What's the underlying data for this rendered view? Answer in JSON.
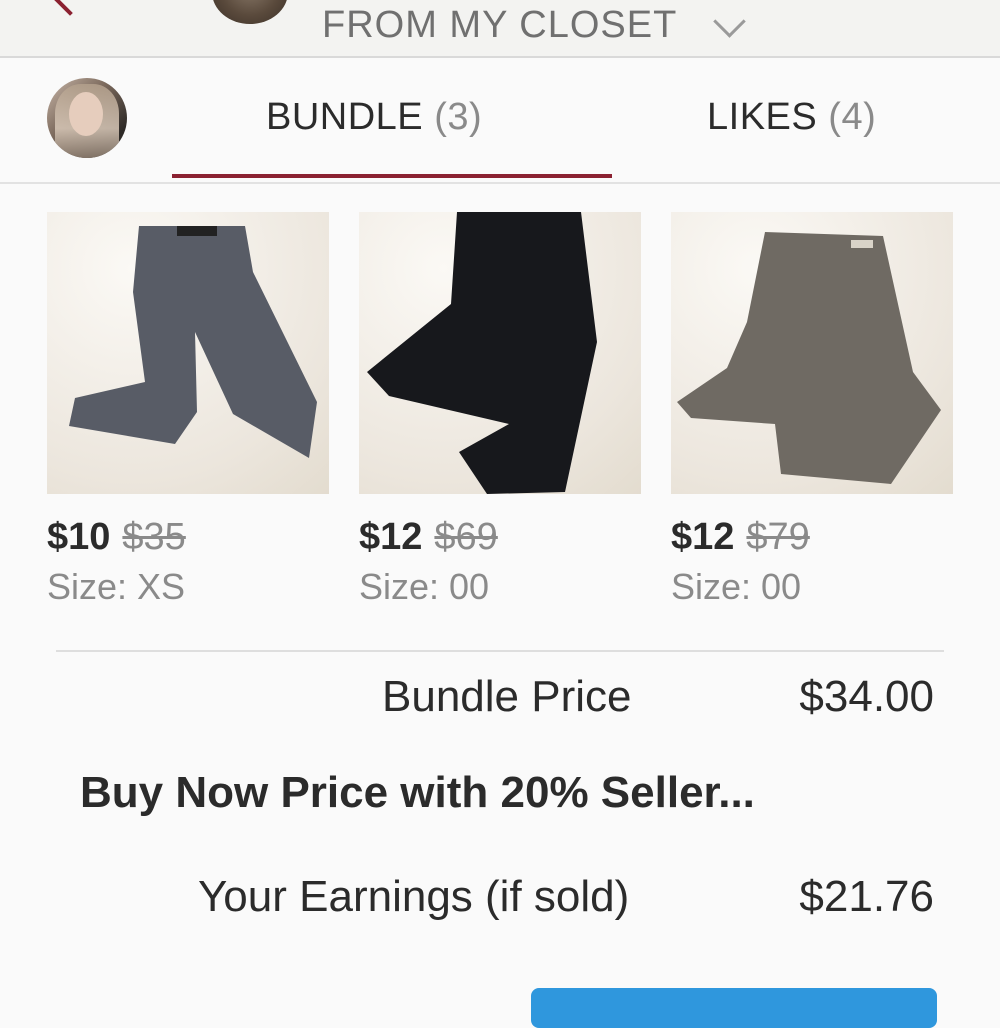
{
  "header": {
    "title": "FROM MY CLOSET"
  },
  "tabs": [
    {
      "label": "BUNDLE",
      "count": "(3)",
      "active": true
    },
    {
      "label": "LIKES",
      "count": "(4)",
      "active": false
    }
  ],
  "items": [
    {
      "price": "$10",
      "original_price": "$35",
      "size": "Size: XS",
      "color": "#585c66"
    },
    {
      "price": "$12",
      "original_price": "$69",
      "size": "Size: 00",
      "color": "#17181c"
    },
    {
      "price": "$12",
      "original_price": "$79",
      "size": "Size: 00",
      "color": "#6f6a63"
    }
  ],
  "summary": {
    "bundle_price_label": "Bundle Price",
    "bundle_price_value": "$34.00",
    "buy_now_label": "Buy Now Price with 20% Seller...",
    "earnings_label": "Your Earnings (if sold)",
    "earnings_value": "$21.76"
  },
  "colors": {
    "accent": "#8b2131",
    "action_blue": "#2f97dd"
  }
}
